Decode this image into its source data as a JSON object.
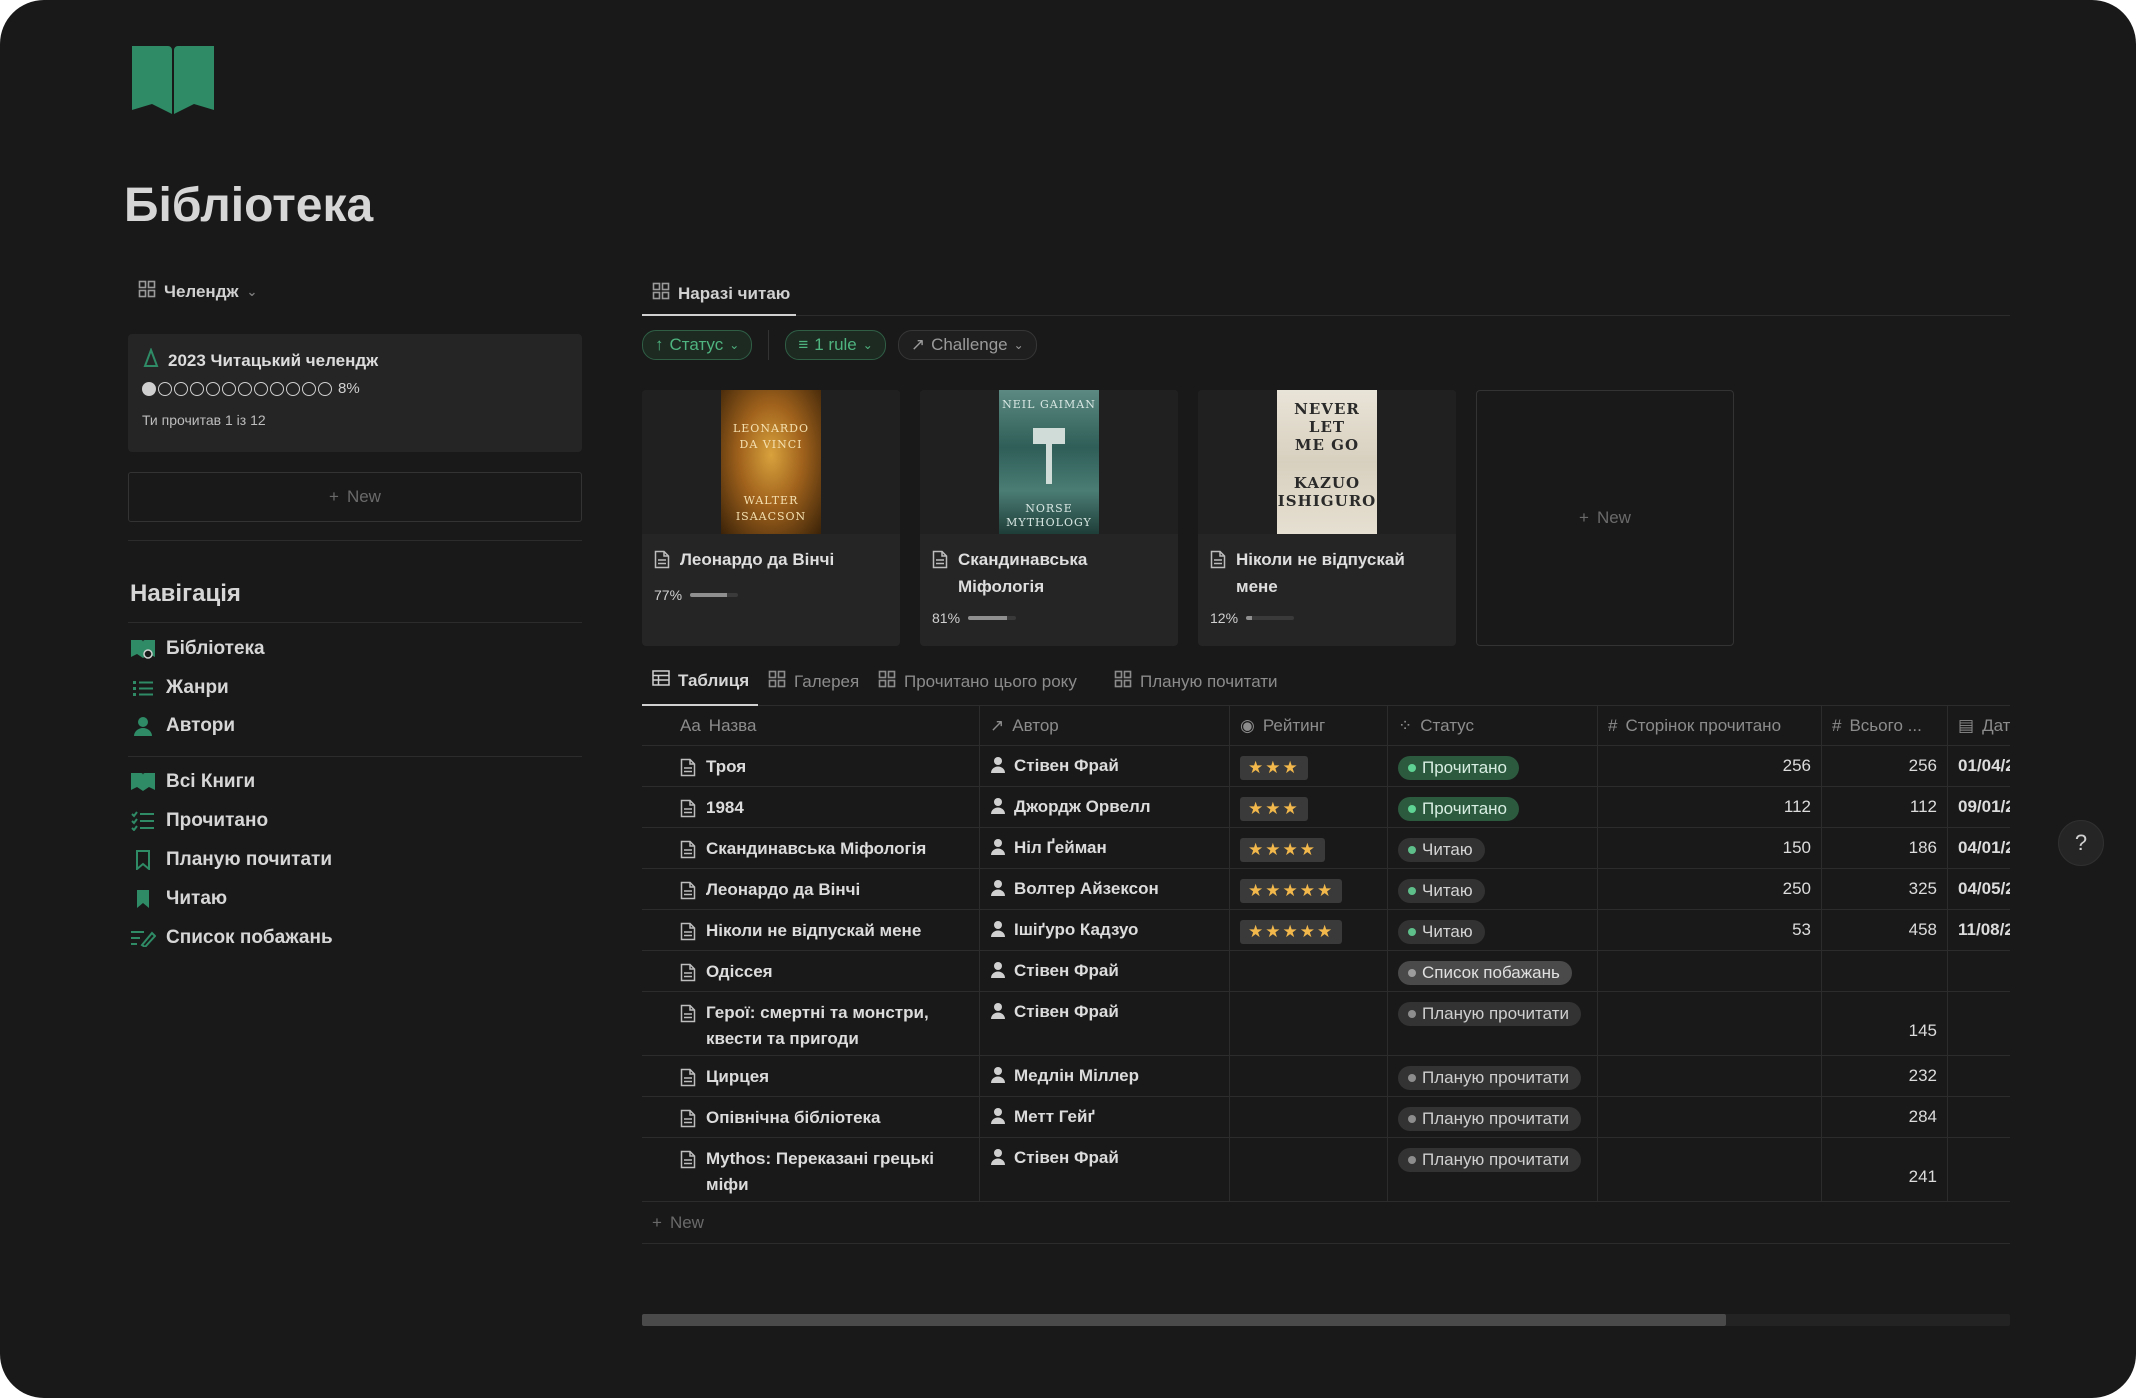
{
  "page": {
    "title": "Бібліотека",
    "accent": "#2e8b66"
  },
  "left": {
    "view_tab": "Челендж",
    "challenge": {
      "title": "2023 Читацький челендж",
      "percent": "8%",
      "dots_total": 12,
      "dots_filled": 1,
      "subtitle": "Ти прочитав 1 із 12"
    },
    "new_label": "New",
    "nav_heading": "Навігація",
    "nav_group1": [
      {
        "label": "Бібліотека",
        "icon": "library-icon"
      },
      {
        "label": "Жанри",
        "icon": "list-icon"
      },
      {
        "label": "Автори",
        "icon": "person-icon"
      }
    ],
    "nav_group2": [
      {
        "label": "Всі Книги",
        "icon": "book-icon"
      },
      {
        "label": "Прочитано",
        "icon": "checklist-icon"
      },
      {
        "label": "Планую почитати",
        "icon": "bookmark-outline-icon"
      },
      {
        "label": "Читаю",
        "icon": "bookmark-icon"
      },
      {
        "label": "Список побажань",
        "icon": "edit-list-icon"
      }
    ]
  },
  "main": {
    "tab": "Наразі читаю",
    "filters": {
      "sort": "Статус",
      "rule": "1 rule",
      "challenge": "Challenge"
    },
    "gallery": [
      {
        "title": "Леонардо да Вінчі",
        "progress_label": "77%",
        "progress": 0.77,
        "cover": {
          "lines": [
            "LEONARDO",
            "DA VINCI",
            "WALTER",
            "ISAACSON"
          ]
        }
      },
      {
        "title": "Скандинавська Міфологія",
        "progress_label": "81%",
        "progress": 0.81,
        "cover": {
          "lines": [
            "NEIL GAIMAN",
            "NORSE",
            "MYTHOLOGY"
          ]
        }
      },
      {
        "title": "Ніколи не відпускай мене",
        "progress_label": "12%",
        "progress": 0.12,
        "cover": {
          "lines": [
            "NEVER",
            "LET",
            "ME GO",
            "KAZUO",
            "ISHIGURO"
          ]
        }
      }
    ],
    "gallery_new": "New",
    "views": [
      "Таблиця",
      "Галерея",
      "Прочитано цього року",
      "Планую почитати"
    ],
    "table": {
      "headers": [
        "Назва",
        "Автор",
        "Рейтинг",
        "Статус",
        "Сторінок прочитано",
        "Всього ...",
        "Дат"
      ],
      "name_prefix": "Aa",
      "rows": [
        {
          "name": "Троя",
          "author": "Стівен Фрай",
          "rating": "★★★",
          "status": "Прочитано",
          "status_kind": "done",
          "read": "256",
          "total": "256",
          "date": "01/04/2"
        },
        {
          "name": "1984",
          "author": "Джордж Орвелл",
          "rating": "★★★",
          "status": "Прочитано",
          "status_kind": "done",
          "read": "112",
          "total": "112",
          "date": "09/01/2"
        },
        {
          "name": "Скандинавська Міфологія",
          "author": "Ніл Ґейман",
          "rating": "★★★★",
          "status": "Читаю",
          "status_kind": "reading",
          "read": "150",
          "total": "186",
          "date": "04/01/2"
        },
        {
          "name": "Леонардо да Вінчі",
          "author": "Волтер Айзексон",
          "rating": "★★★★★",
          "status": "Читаю",
          "status_kind": "reading",
          "read": "250",
          "total": "325",
          "date": "04/05/2"
        },
        {
          "name": "Ніколи не відпускай мене",
          "author": "Ішіґуро Кадзуо",
          "rating": "★★★★★",
          "status": "Читаю",
          "status_kind": "reading",
          "read": "53",
          "total": "458",
          "date": "11/08/2"
        },
        {
          "name": "Одіссея",
          "author": "Стівен Фрай",
          "rating": "",
          "status": "Список побажань",
          "status_kind": "wish",
          "read": "",
          "total": "",
          "date": ""
        },
        {
          "name": "Герої: смертні та монстри, квести та пригоди",
          "author": "Стівен Фрай",
          "rating": "",
          "status": "Планую прочитати",
          "status_kind": "plan",
          "read": "",
          "total": "145",
          "date": ""
        },
        {
          "name": "Цирцея",
          "author": "Медлін Міллер",
          "rating": "",
          "status": "Планую прочитати",
          "status_kind": "plan",
          "read": "",
          "total": "232",
          "date": ""
        },
        {
          "name": "Опівнічна бібліотека",
          "author": "Метт Гейґ",
          "rating": "",
          "status": "Планую прочитати",
          "status_kind": "plan",
          "read": "",
          "total": "284",
          "date": ""
        },
        {
          "name": "Mythos: Переказані грецькі міфи",
          "author": "Стівен Фрай",
          "rating": "",
          "status": "Планую прочитати",
          "status_kind": "plan",
          "read": "",
          "total": "241",
          "date": ""
        }
      ],
      "new_label": "New"
    },
    "help_label": "?"
  }
}
